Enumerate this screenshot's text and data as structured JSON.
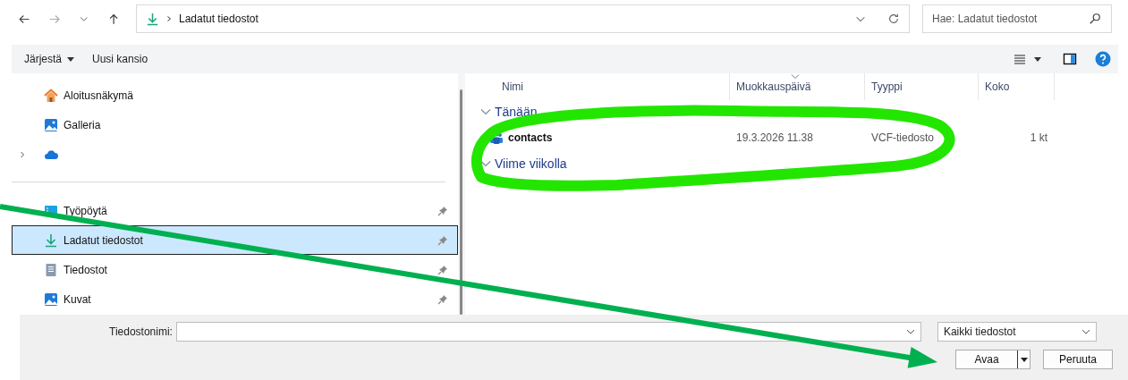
{
  "navigation": {
    "back_enabled": true,
    "forward_enabled": false
  },
  "address_bar": {
    "path": "Ladatut tiedostot"
  },
  "search": {
    "placeholder": "Hae: Ladatut tiedostot"
  },
  "toolbar": {
    "organize": "Järjestä",
    "new_folder": "Uusi kansio"
  },
  "sidebar": {
    "sections": [
      {
        "items": [
          {
            "label": "Aloitusnäkymä",
            "kind": "home",
            "pinned": false,
            "selected": false,
            "expandable": false
          },
          {
            "label": "Galleria",
            "kind": "gallery",
            "pinned": false,
            "selected": false,
            "expandable": false
          },
          {
            "kind": "cloud",
            "pinned": false,
            "selected": false,
            "expandable": true
          }
        ]
      },
      {
        "items": [
          {
            "label": "Työpöytä",
            "kind": "desktop",
            "pinned": true,
            "selected": false,
            "expandable": false
          },
          {
            "label": "Ladatut tiedostot",
            "kind": "download",
            "pinned": true,
            "selected": true,
            "expandable": false
          },
          {
            "label": "Tiedostot",
            "kind": "documents",
            "pinned": true,
            "selected": false,
            "expandable": false
          },
          {
            "label": "Kuvat",
            "kind": "pictures",
            "pinned": true,
            "selected": false,
            "expandable": false
          }
        ]
      }
    ]
  },
  "file_list": {
    "columns": [
      {
        "label": "Nimi",
        "sorted": false
      },
      {
        "label": "Muokkauspäivä",
        "sorted": true
      },
      {
        "label": "Tyyppi",
        "sorted": false
      },
      {
        "label": "Koko",
        "sorted": false
      }
    ],
    "groups": [
      {
        "title": "Tänään",
        "expanded": true,
        "files": [
          {
            "name": "contacts",
            "modified": "19.3.2026 11.38",
            "type": "VCF-tiedosto",
            "size": "1 kt"
          }
        ]
      },
      {
        "title": "Viime viikolla",
        "expanded": true
      }
    ]
  },
  "footer": {
    "filename_label": "Tiedostonimi:",
    "filter": "Kaikki tiedostot",
    "buttons": [
      {
        "label": "Avaa",
        "kind": "split"
      },
      {
        "label": "Peruuta",
        "kind": "plain"
      }
    ]
  },
  "annotations": [
    {
      "kind": "scribble_ellipse",
      "color": "#22e600"
    },
    {
      "kind": "arrow",
      "color": "#00b050"
    }
  ]
}
